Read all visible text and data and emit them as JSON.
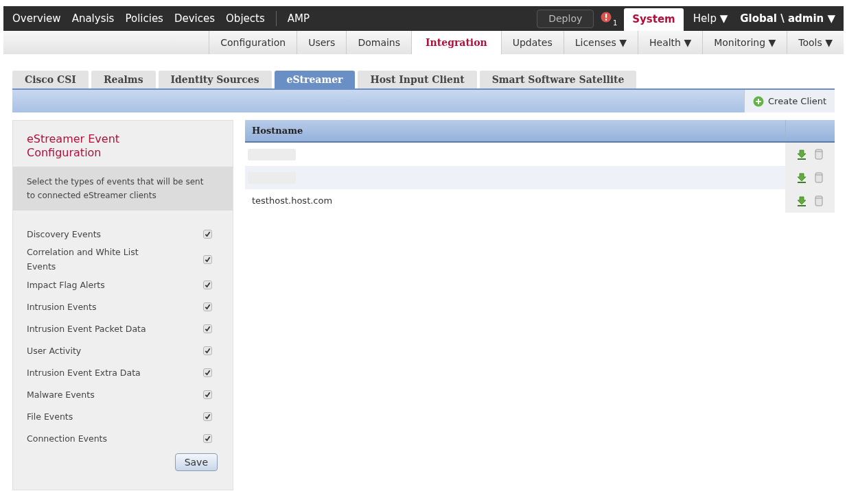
{
  "main_nav": {
    "items": [
      {
        "label": "Overview"
      },
      {
        "label": "Analysis"
      },
      {
        "label": "Policies"
      },
      {
        "label": "Devices"
      },
      {
        "label": "Objects"
      },
      {
        "label": "AMP",
        "separated": true
      }
    ],
    "deploy": "Deploy",
    "alert_count": "1",
    "right_items": [
      {
        "label": "System",
        "selected": true
      },
      {
        "label": "Help ▼",
        "selected": false
      },
      {
        "label": "Global \\ admin ▼",
        "selected": false,
        "bold": true
      }
    ]
  },
  "sub_nav": [
    {
      "label": "Configuration",
      "selected": false
    },
    {
      "label": "Users",
      "selected": false
    },
    {
      "label": "Domains",
      "selected": false
    },
    {
      "label": "Integration",
      "selected": true
    },
    {
      "label": "Updates",
      "selected": false
    },
    {
      "label": "Licenses ▼",
      "selected": false
    },
    {
      "label": "Health ▼",
      "selected": false
    },
    {
      "label": "Monitoring ▼",
      "selected": false
    },
    {
      "label": "Tools ▼",
      "selected": false
    }
  ],
  "tabs": [
    {
      "label": "Cisco CSI",
      "selected": false
    },
    {
      "label": "Realms",
      "selected": false
    },
    {
      "label": "Identity Sources",
      "selected": false
    },
    {
      "label": "eStreamer",
      "selected": true
    },
    {
      "label": "Host Input Client",
      "selected": false
    },
    {
      "label": "Smart Software Satellite",
      "selected": false
    }
  ],
  "create_button": "Create Client",
  "config_panel": {
    "title": "eStreamer Event Configuration",
    "description": "Select the types of events that will be sent to connected eStreamer clients",
    "events": [
      {
        "label": "Discovery Events",
        "checked": true
      },
      {
        "label": "Correlation and White List Events",
        "checked": true
      },
      {
        "label": "Impact Flag Alerts",
        "checked": true
      },
      {
        "label": "Intrusion Events",
        "checked": true
      },
      {
        "label": "Intrusion Event Packet Data",
        "checked": true
      },
      {
        "label": "User Activity",
        "checked": true
      },
      {
        "label": "Intrusion Event Extra Data",
        "checked": true
      },
      {
        "label": "Malware Events",
        "checked": true
      },
      {
        "label": "File Events",
        "checked": true
      },
      {
        "label": "Connection Events",
        "checked": true
      }
    ],
    "save": "Save"
  },
  "table": {
    "columns": [
      "Hostname"
    ],
    "rows": [
      {
        "kind": "redacted"
      },
      {
        "kind": "redacted"
      },
      {
        "kind": "text",
        "hostname": "testhost.host.com"
      }
    ]
  }
}
